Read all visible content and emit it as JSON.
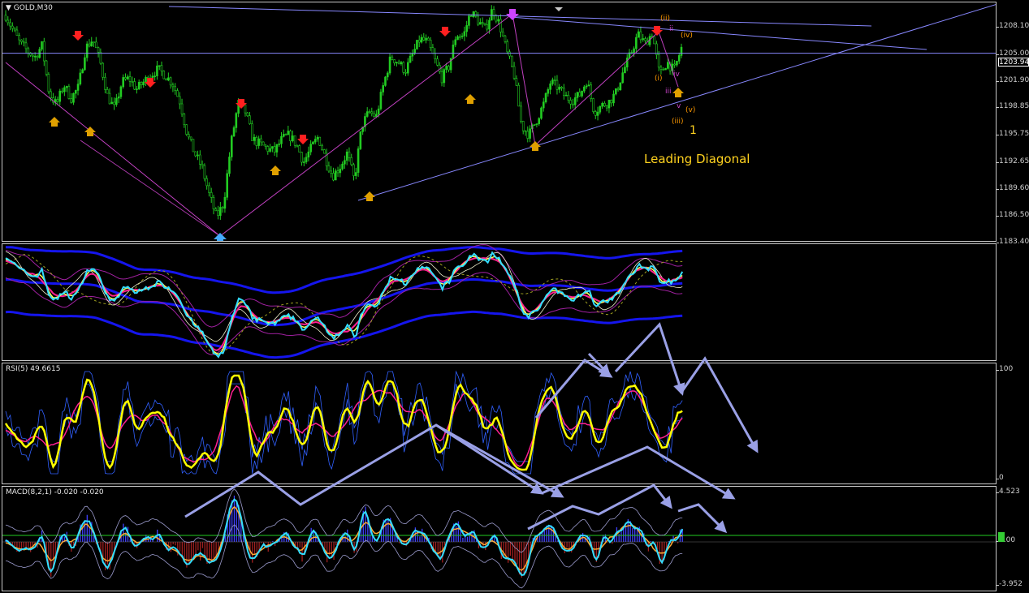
{
  "symbol_label": "GOLD,M30",
  "current_price": "1203.94",
  "annotation": "Leading Diagonal",
  "wave_labels": [
    "(ii)",
    "ii",
    "(iv)",
    "(i)",
    "iii",
    "iv",
    "v",
    "(v)",
    "(iii)",
    "1"
  ],
  "panels": {
    "price": {
      "ticks": [
        "1208.10",
        "1205.00",
        "1201.90",
        "1198.85",
        "1195.75",
        "1192.65",
        "1189.60",
        "1186.50",
        "1183.40"
      ]
    },
    "bands": {
      "ticks": []
    },
    "rsi": {
      "label": "RSI(5) 49.6615",
      "ticks": [
        "100",
        "0"
      ]
    },
    "macd": {
      "label": "MACD(8,2,1) -0.020 -0.020",
      "ticks": [
        "4.523",
        "0.00",
        "-3.952"
      ]
    }
  },
  "colors": {
    "candles": "#22cc22",
    "trendline": "#8888ff",
    "zigzag": "#c040c0",
    "up_arrow": "#e0a000",
    "down_arrow": "#ff2020",
    "rsi_line": "#ffff00",
    "signal": "#ff2090",
    "annotation": "#ffd21f",
    "projection_arrows": "#9aa0e6"
  },
  "chart_data": [
    {
      "type": "candlestick",
      "title": "GOLD,M30",
      "ylim": [
        1183.4,
        1209.5
      ],
      "close_path": [
        1208.1,
        1206.5,
        1205.0,
        1204.2,
        1203.5,
        1204.8,
        1199.5,
        1198.3,
        1200.5,
        1199.0,
        1200.2,
        1204.5,
        1205.5,
        1203.0,
        1199.3,
        1197.8,
        1200.8,
        1201.2,
        1200.0,
        1200.8,
        1201.6,
        1202.2,
        1201.5,
        1200.6,
        1198.6,
        1195.0,
        1193.0,
        1191.5,
        1188.5,
        1186.0,
        1187.5,
        1194.0,
        1198.5,
        1197.5,
        1194.5,
        1194.0,
        1193.5,
        1193.2,
        1194.5,
        1195.0,
        1194.0,
        1192.0,
        1193.5,
        1194.8,
        1192.5,
        1190.5,
        1191.5,
        1193.0,
        1190.0,
        1196.0,
        1197.5,
        1197.0,
        1200.5,
        1203.5,
        1203.0,
        1202.0,
        1203.8,
        1205.5,
        1205.2,
        1203.3,
        1201.2,
        1202.5,
        1206.0,
        1205.8,
        1208.5,
        1207.5,
        1206.5,
        1208.8,
        1207.0,
        1204.0,
        1201.5,
        1196.0,
        1195.0,
        1196.5,
        1198.3,
        1200.8,
        1200.2,
        1199.2,
        1198.8,
        1199.4,
        1201.0,
        1197.5,
        1198.2,
        1198.6,
        1199.6,
        1202.0,
        1203.8,
        1206.0,
        1205.0,
        1206.2,
        1201.5,
        1203.0,
        1202.0,
        1204.5
      ],
      "horizontal_line": 1203.94,
      "series": [
        {
          "name": "GOLD,M30"
        }
      ]
    },
    {
      "type": "line",
      "title": "",
      "series": [
        {
          "name": "bands"
        }
      ]
    },
    {
      "type": "line",
      "title": "RSI(5) 49.6615",
      "ylim": [
        0,
        100
      ],
      "series": [
        {
          "name": "RSI(5)"
        }
      ]
    },
    {
      "type": "bar",
      "title": "MACD(8,2,1) -0.020 -0.020",
      "ylim": [
        -3.952,
        4.523
      ],
      "series": [
        {
          "name": "MACD(8,2,1)"
        }
      ]
    }
  ]
}
